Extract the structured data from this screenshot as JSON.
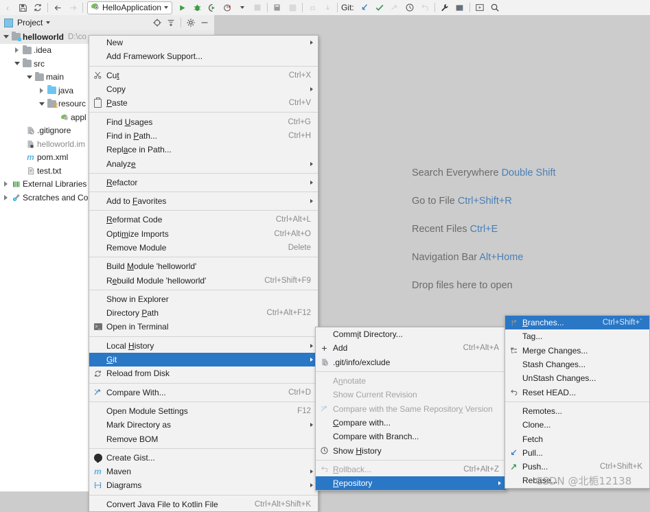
{
  "toolbar": {
    "icons_left": [
      "save-icon",
      "sync-icon"
    ],
    "nav_back": "back-arrow-icon",
    "nav_forward": "forward-arrow-icon",
    "run_config": "HelloApplication",
    "run_icon": "run-icon",
    "debug_icon": "debug-icon",
    "run_coverage_icon": "run-with-coverage-icon",
    "profile_icon": "profile-icon",
    "stop_icon": "stop-icon",
    "settings_icon": "settings-icon",
    "layout_icon": "layout-icon",
    "git_label": "Git:",
    "git_update_icon": "update-project-icon",
    "git_commit_icon": "commit-icon",
    "git_push_icon": "push-icon",
    "git_history_icon": "history-icon",
    "git_rollback_icon": "rollback-icon",
    "wrench_icon": "wrench-icon",
    "structure_icon": "structure-icon",
    "run_anything_icon": "run-anything-icon",
    "search_icon": "search-icon"
  },
  "project_panel": {
    "title": "Project",
    "actions": [
      "locate-icon",
      "collapse-all-icon",
      "gear-icon",
      "hide-icon"
    ],
    "tree": [
      {
        "label": "helloworld",
        "path": "D:\\co",
        "depth": 0,
        "arrow": "down",
        "icon": "module-folder",
        "bold": true,
        "selected": true
      },
      {
        "label": ".idea",
        "depth": 1,
        "arrow": "right",
        "icon": "folder-gray"
      },
      {
        "label": "src",
        "depth": 1,
        "arrow": "down",
        "icon": "folder-gray"
      },
      {
        "label": "main",
        "depth": 2,
        "arrow": "down",
        "icon": "folder-gray"
      },
      {
        "label": "java",
        "depth": 3,
        "arrow": "right",
        "icon": "folder-blue"
      },
      {
        "label": "resourc",
        "depth": 3,
        "arrow": "down",
        "icon": "folder-resources"
      },
      {
        "label": "appl",
        "depth": 4,
        "arrow": "none",
        "icon": "yaml-file"
      },
      {
        "label": ".gitignore",
        "depth": 2,
        "arrow": "none",
        "icon": "gitignore-file"
      },
      {
        "label": "helloworld.im",
        "depth": 2,
        "arrow": "none",
        "icon": "iml-file",
        "dim": true
      },
      {
        "label": "pom.xml",
        "depth": 2,
        "arrow": "none",
        "icon": "maven-file"
      },
      {
        "label": "test.txt",
        "depth": 2,
        "arrow": "none",
        "icon": "text-file"
      },
      {
        "label": "External Libraries",
        "depth": 0,
        "arrow": "right",
        "icon": "libraries-icon"
      },
      {
        "label": "Scratches and Co",
        "depth": 0,
        "arrow": "right",
        "icon": "scratches-icon"
      }
    ]
  },
  "editor": {
    "hints": [
      {
        "text": "Search Everywhere ",
        "key": "Double Shift"
      },
      {
        "text": "Go to File ",
        "key": "Ctrl+Shift+R"
      },
      {
        "text": "Recent Files ",
        "key": "Ctrl+E"
      },
      {
        "text": "Navigation Bar ",
        "key": "Alt+Home"
      },
      {
        "text": "Drop files here to open",
        "key": ""
      }
    ]
  },
  "context_menu": {
    "items": [
      {
        "label": "New",
        "shortcut": "",
        "submenu": true,
        "icon": ""
      },
      {
        "label": "Add Framework Support...",
        "shortcut": "",
        "submenu": false,
        "icon": ""
      },
      {
        "sep": true
      },
      {
        "label": "Cut",
        "shortcut": "Ctrl+X",
        "submenu": false,
        "icon": "scissors-icon",
        "mnemonic": 2
      },
      {
        "label": "Copy",
        "shortcut": "",
        "submenu": true,
        "icon": ""
      },
      {
        "label": "Paste",
        "shortcut": "Ctrl+V",
        "submenu": false,
        "icon": "clipboard-icon",
        "mnemonic": 0
      },
      {
        "sep": true
      },
      {
        "label": "Find Usages",
        "shortcut": "Ctrl+G",
        "submenu": false,
        "icon": "",
        "mnemonic": 5
      },
      {
        "label": "Find in Path...",
        "shortcut": "Ctrl+H",
        "submenu": false,
        "icon": "",
        "mnemonic": 8
      },
      {
        "label": "Replace in Path...",
        "shortcut": "",
        "submenu": false,
        "icon": "",
        "mnemonic": 4
      },
      {
        "label": "Analyze",
        "shortcut": "",
        "submenu": true,
        "icon": "",
        "mnemonic": 6
      },
      {
        "sep": true
      },
      {
        "label": "Refactor",
        "shortcut": "",
        "submenu": true,
        "icon": "",
        "mnemonic": 0
      },
      {
        "sep": true
      },
      {
        "label": "Add to Favorites",
        "shortcut": "",
        "submenu": true,
        "icon": "",
        "mnemonic": 7
      },
      {
        "sep": true
      },
      {
        "label": "Reformat Code",
        "shortcut": "Ctrl+Alt+L",
        "submenu": false,
        "icon": "",
        "mnemonic": 0
      },
      {
        "label": "Optimize Imports",
        "shortcut": "Ctrl+Alt+O",
        "submenu": false,
        "icon": "",
        "mnemonic": 4
      },
      {
        "label": "Remove Module",
        "shortcut": "Delete",
        "submenu": false,
        "icon": ""
      },
      {
        "sep": true
      },
      {
        "label": "Build Module 'helloworld'",
        "shortcut": "",
        "submenu": false,
        "icon": "",
        "mnemonic": 6
      },
      {
        "label": "Rebuild Module 'helloworld'",
        "shortcut": "Ctrl+Shift+F9",
        "submenu": false,
        "icon": "",
        "mnemonic": 1
      },
      {
        "sep": true
      },
      {
        "label": "Show in Explorer",
        "shortcut": "",
        "submenu": false,
        "icon": ""
      },
      {
        "label": "Directory Path",
        "shortcut": "Ctrl+Alt+F12",
        "submenu": false,
        "icon": "",
        "mnemonic": 10
      },
      {
        "label": "Open in Terminal",
        "shortcut": "",
        "submenu": false,
        "icon": "terminal-icon"
      },
      {
        "sep": true
      },
      {
        "label": "Local History",
        "shortcut": "",
        "submenu": true,
        "icon": "",
        "mnemonic": 6
      },
      {
        "label": "Git",
        "shortcut": "",
        "submenu": true,
        "icon": "",
        "selected": true,
        "mnemonic": 0
      },
      {
        "label": "Reload from Disk",
        "shortcut": "",
        "submenu": false,
        "icon": "reload-icon"
      },
      {
        "sep": true
      },
      {
        "label": "Compare With...",
        "shortcut": "Ctrl+D",
        "submenu": false,
        "icon": "compare-icon"
      },
      {
        "sep": true
      },
      {
        "label": "Open Module Settings",
        "shortcut": "F12",
        "submenu": false,
        "icon": ""
      },
      {
        "label": "Mark Directory as",
        "shortcut": "",
        "submenu": true,
        "icon": ""
      },
      {
        "label": "Remove BOM",
        "shortcut": "",
        "submenu": false,
        "icon": ""
      },
      {
        "sep": true
      },
      {
        "label": "Create Gist...",
        "shortcut": "",
        "submenu": false,
        "icon": "github-icon"
      },
      {
        "label": "Maven",
        "shortcut": "",
        "submenu": true,
        "icon": "maven-icon"
      },
      {
        "label": "Diagrams",
        "shortcut": "",
        "submenu": true,
        "icon": "diagrams-icon"
      },
      {
        "sep": true
      },
      {
        "label": "Convert Java File to Kotlin File",
        "shortcut": "Ctrl+Alt+Shift+K",
        "submenu": false,
        "icon": ""
      }
    ]
  },
  "git_submenu": {
    "items": [
      {
        "label": "Commit Directory...",
        "shortcut": "",
        "submenu": false,
        "icon": "",
        "mnemonic": 4
      },
      {
        "label": "Add",
        "shortcut": "Ctrl+Alt+A",
        "submenu": false,
        "icon": "plus-icon"
      },
      {
        "label": ".git/info/exclude",
        "shortcut": "",
        "submenu": false,
        "icon": "git-exclude-icon"
      },
      {
        "sep": true
      },
      {
        "label": "Annotate",
        "shortcut": "",
        "submenu": false,
        "icon": "",
        "disabled": true,
        "mnemonic": 1
      },
      {
        "label": "Show Current Revision",
        "shortcut": "",
        "submenu": false,
        "icon": "",
        "disabled": true
      },
      {
        "label": "Compare with the Same Repository Version",
        "shortcut": "",
        "submenu": false,
        "icon": "compare-icon",
        "disabled": true,
        "mnemonic": 31
      },
      {
        "label": "Compare with...",
        "shortcut": "",
        "submenu": false,
        "icon": "",
        "mnemonic": 0
      },
      {
        "label": "Compare with Branch...",
        "shortcut": "",
        "submenu": false,
        "icon": ""
      },
      {
        "label": "Show History",
        "shortcut": "",
        "submenu": false,
        "icon": "clock-icon",
        "mnemonic": 5
      },
      {
        "sep": true
      },
      {
        "label": "Rollback...",
        "shortcut": "Ctrl+Alt+Z",
        "submenu": false,
        "icon": "undo-icon",
        "disabled": true,
        "mnemonic": 0
      },
      {
        "label": "Repository",
        "shortcut": "",
        "submenu": true,
        "icon": "",
        "selected": true,
        "mnemonic": 0
      }
    ]
  },
  "repository_submenu": {
    "items": [
      {
        "label": "Branches...",
        "shortcut": "Ctrl+Shift+`",
        "submenu": false,
        "icon": "branch-icon",
        "selected": true,
        "mnemonic": 0
      },
      {
        "label": "Tag...",
        "shortcut": "",
        "submenu": false,
        "icon": ""
      },
      {
        "label": "Merge Changes...",
        "shortcut": "",
        "submenu": false,
        "icon": "merge-icon"
      },
      {
        "label": "Stash Changes...",
        "shortcut": "",
        "submenu": false,
        "icon": ""
      },
      {
        "label": "UnStash Changes...",
        "shortcut": "",
        "submenu": false,
        "icon": ""
      },
      {
        "label": "Reset HEAD...",
        "shortcut": "",
        "submenu": false,
        "icon": "undo-icon"
      },
      {
        "sep": true
      },
      {
        "label": "Remotes...",
        "shortcut": "",
        "submenu": false,
        "icon": ""
      },
      {
        "label": "Clone...",
        "shortcut": "",
        "submenu": false,
        "icon": ""
      },
      {
        "label": "Fetch",
        "shortcut": "",
        "submenu": false,
        "icon": ""
      },
      {
        "label": "Pull...",
        "shortcut": "",
        "submenu": false,
        "icon": "pull-icon"
      },
      {
        "label": "Push...",
        "shortcut": "Ctrl+Shift+K",
        "submenu": false,
        "icon": "push-icon"
      },
      {
        "label": "Rebase...",
        "shortcut": "",
        "submenu": false,
        "icon": ""
      }
    ]
  },
  "watermark": {
    "text": "CSDN @北栀12138"
  },
  "colors": {
    "highlight": "#2a77c6",
    "menu_bg": "#f2f2f2",
    "editor_bg": "#cccccc",
    "tree_bg": "#ffffff",
    "hint_key": "#4b7fb5"
  }
}
